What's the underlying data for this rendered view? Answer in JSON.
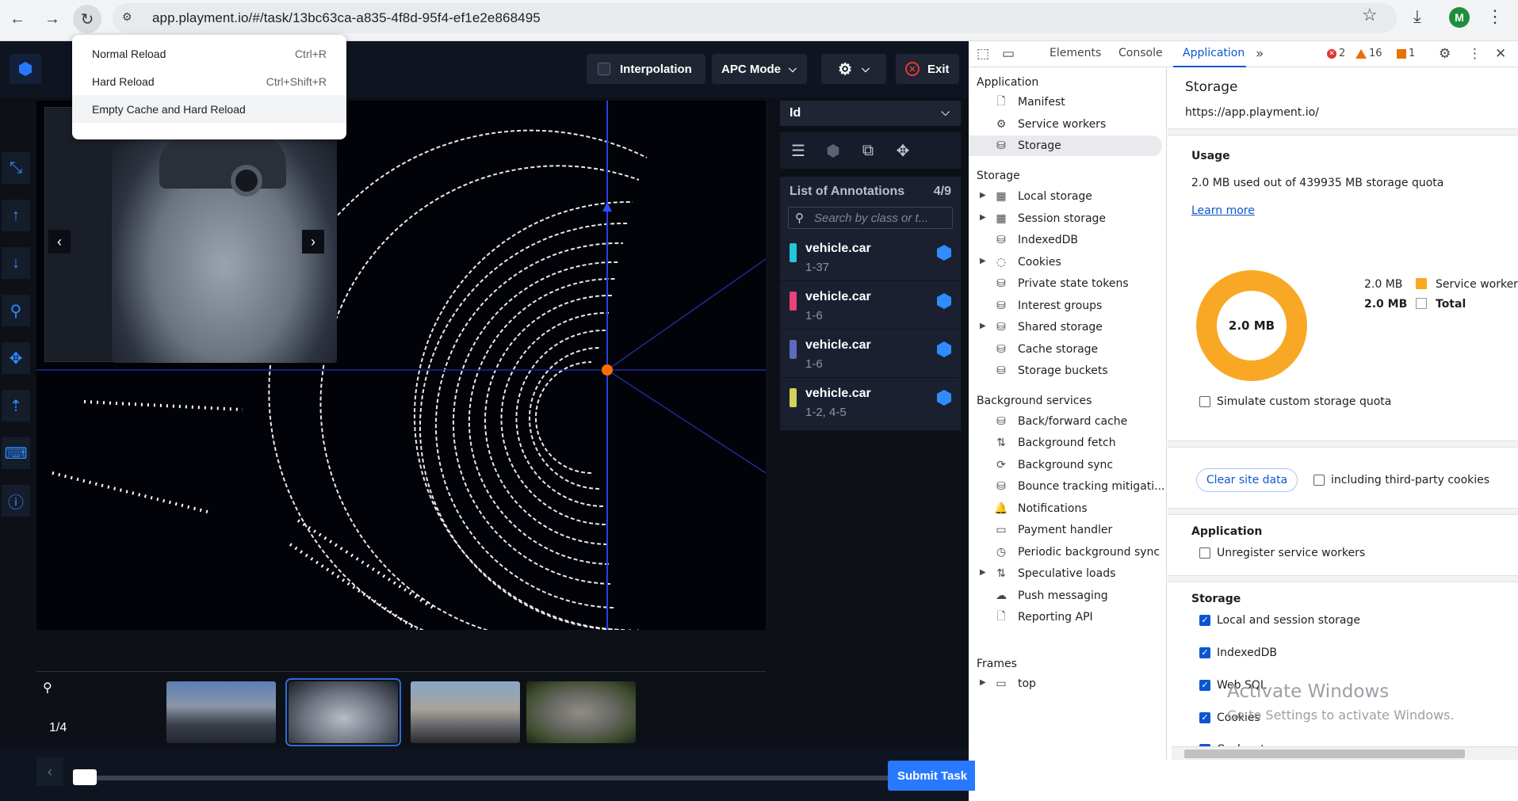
{
  "browser": {
    "url": "app.playment.io/#/task/13bc63ca-a835-4f8d-95f4-ef1e2e868495",
    "profile_initial": "M"
  },
  "reload_menu": {
    "items": [
      {
        "label": "Normal Reload",
        "shortcut": "Ctrl+R"
      },
      {
        "label": "Hard Reload",
        "shortcut": "Ctrl+Shift+R"
      },
      {
        "label": "Empty Cache and Hard Reload",
        "shortcut": ""
      }
    ]
  },
  "app": {
    "interpolation_label": "Interpolation",
    "mode_label": "APC Mode",
    "exit_label": "Exit",
    "frame_counter": "1/4",
    "submit_label": "Submit Task",
    "id_select": "Id",
    "annotations": {
      "title": "List of Annotations",
      "count": "4/9",
      "search_placeholder": "Search by class or t...",
      "items": [
        {
          "label": "vehicle.car",
          "range": "1-37",
          "color": "#26c6da"
        },
        {
          "label": "vehicle.car",
          "range": "1-6",
          "color": "#ec407a"
        },
        {
          "label": "vehicle.car",
          "range": "1-6",
          "color": "#5c6bc0"
        },
        {
          "label": "vehicle.car",
          "range": "1-2, 4-5",
          "color": "#d4d15c"
        }
      ]
    }
  },
  "devtools": {
    "tabs": [
      "Elements",
      "Console",
      "Application"
    ],
    "active_tab": "Application",
    "errors": "2",
    "warnings": "16",
    "issues": "1",
    "sidebar": {
      "application_head": "Application",
      "application_items": [
        "Manifest",
        "Service workers",
        "Storage"
      ],
      "storage_head": "Storage",
      "storage_items": [
        "Local storage",
        "Session storage",
        "IndexedDB",
        "Cookies",
        "Private state tokens",
        "Interest groups",
        "Shared storage",
        "Cache storage",
        "Storage buckets"
      ],
      "background_head": "Background services",
      "background_items": [
        "Back/forward cache",
        "Background fetch",
        "Background sync",
        "Bounce tracking mitigati...",
        "Notifications",
        "Payment handler",
        "Periodic background sync",
        "Speculative loads",
        "Push messaging",
        "Reporting API"
      ],
      "frames_head": "Frames",
      "frames_items": [
        "top"
      ]
    },
    "main": {
      "title": "Storage",
      "origin": "https://app.playment.io/",
      "usage_head": "Usage",
      "usage_text": "2.0 MB used out of 439935 MB storage quota",
      "learn_more": "Learn more",
      "donut_label": "2.0 MB",
      "legend": [
        {
          "value": "2.0 MB",
          "name": "Service workers",
          "color": "#f9a825"
        },
        {
          "value": "2.0 MB",
          "name": "Total",
          "color": "#ffffff"
        }
      ],
      "simulate_label": "Simulate custom storage quota",
      "clear_button": "Clear site data",
      "third_party_label": "including third-party cookies",
      "application_head": "Application",
      "unregister_label": "Unregister service workers",
      "storage_head": "Storage",
      "storage_checks": [
        "Local and session storage",
        "IndexedDB",
        "Web SQL",
        "Cookies",
        "Cache storage"
      ]
    }
  },
  "watermark": {
    "title": "Activate Windows",
    "subtitle": "Go to Settings to activate Windows."
  }
}
